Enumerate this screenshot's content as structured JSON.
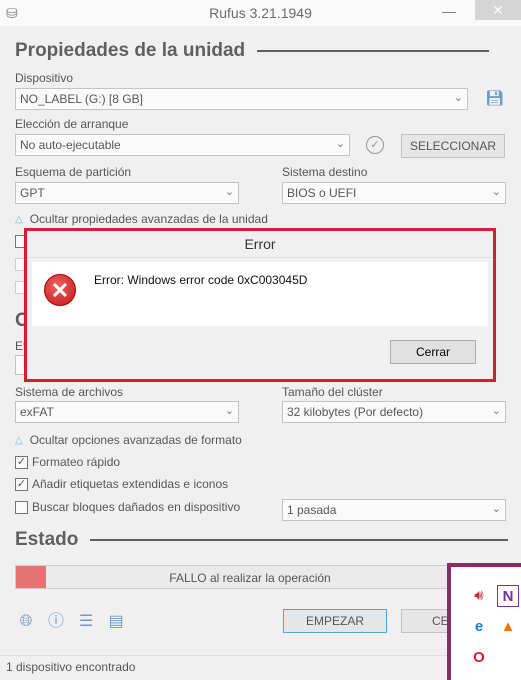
{
  "window": {
    "title": "Rufus 3.21.1949",
    "minimize_glyph": "—",
    "close_glyph": "✕"
  },
  "drive": {
    "section_title": "Propiedades de la unidad",
    "device_label": "Dispositivo",
    "device_value": "NO_LABEL (G:) [8 GB]",
    "boot_label": "Elección de arranque",
    "boot_value": "No auto-ejecutable",
    "select_button": "SELECCIONAR",
    "partition_label": "Esquema de partición",
    "partition_value": "GPT",
    "target_label": "Sistema destino",
    "target_value": "BIOS o UEFI",
    "advanced_toggle": "Ocultar propiedades avanzadas de la unidad"
  },
  "format": {
    "fs_label": "Sistema de archivos",
    "fs_value": "exFAT",
    "cluster_label": "Tamaño del clúster",
    "cluster_value": "32 kilobytes (Por defecto)",
    "advanced_toggle": "Ocultar opciones avanzadas de formato",
    "quick_format": "Formateo rápido",
    "quick_format_checked": true,
    "extended_label": "Añadir etiquetas extendidas e iconos",
    "extended_checked": true,
    "bad_blocks": "Buscar bloques dañados en dispositivo",
    "bad_blocks_checked": false,
    "passes_value": "1 pasada"
  },
  "status": {
    "section_title": "Estado",
    "progress_text": "FALLO al realizar la operación",
    "progress_fraction": 0.065,
    "progress_color": "#e03030"
  },
  "actions": {
    "start": "EMPEZAR",
    "close_partial": "CE"
  },
  "statusbar": {
    "text": "1 dispositivo encontrado"
  },
  "dialog": {
    "title": "Error",
    "message": "Error: Windows error code 0xC003045D",
    "ok_button": "Cerrar",
    "border_color": "#d42030"
  },
  "icons": [
    "globe-icon",
    "info-icon",
    "settings-sliders-icon",
    "log-icon",
    "save-icon",
    "checkmark-icon",
    "error-icon",
    "speaker-icon",
    "onenote-icon",
    "edge-icon",
    "vlc-icon",
    "opera-icon"
  ]
}
